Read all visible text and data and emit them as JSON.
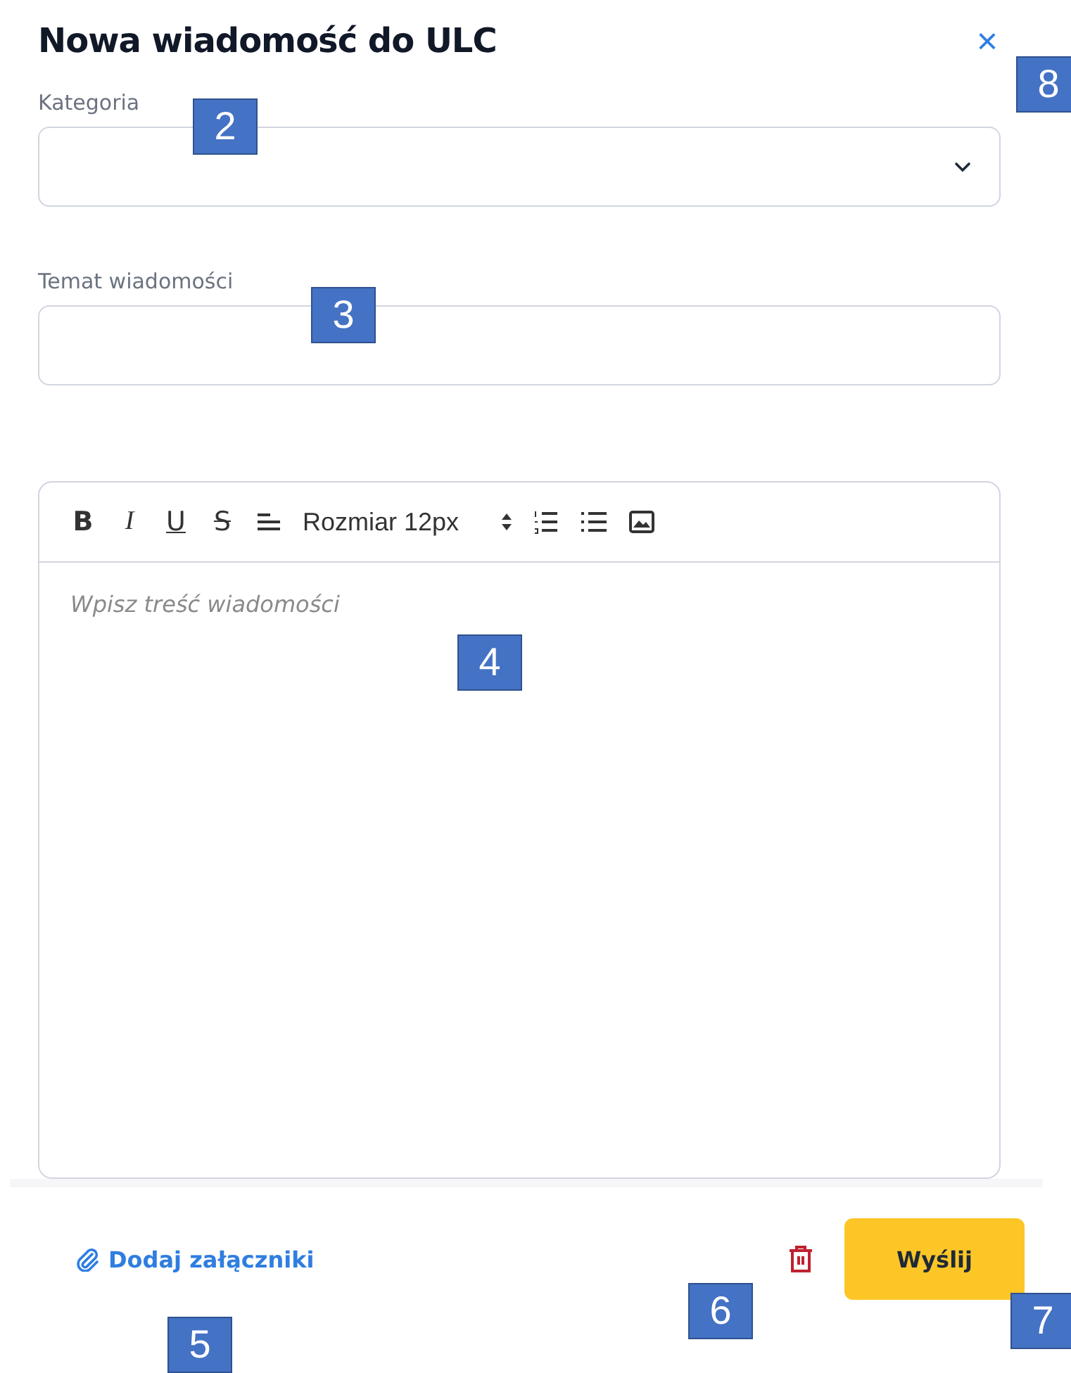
{
  "dialog": {
    "title": "Nowa wiadomość do ULC",
    "close": "×"
  },
  "fields": [
    {
      "label": "Kategoria",
      "kind": "select"
    },
    {
      "label": "Temat wiadomości",
      "kind": "text"
    }
  ],
  "editor": {
    "toolbar": [
      {
        "kind": "bold",
        "label": "B"
      },
      {
        "kind": "italic",
        "label": "I"
      },
      {
        "kind": "underline",
        "label": "U"
      },
      {
        "kind": "strike",
        "label": "S"
      },
      {
        "kind": "align"
      },
      {
        "kind": "size",
        "label": "Rozmiar 12px"
      },
      {
        "kind": "ordered-list"
      },
      {
        "kind": "bullet-list"
      },
      {
        "kind": "image"
      }
    ],
    "placeholder": "Wpisz treść wiadomości"
  },
  "footer": {
    "attach_link": "Dodaj załączniki",
    "send_button": "Wyślij"
  },
  "callouts": [
    {
      "label": "2"
    },
    {
      "label": "3"
    },
    {
      "label": "4"
    },
    {
      "label": "5"
    },
    {
      "label": "6"
    },
    {
      "label": "7"
    },
    {
      "label": "8"
    }
  ]
}
